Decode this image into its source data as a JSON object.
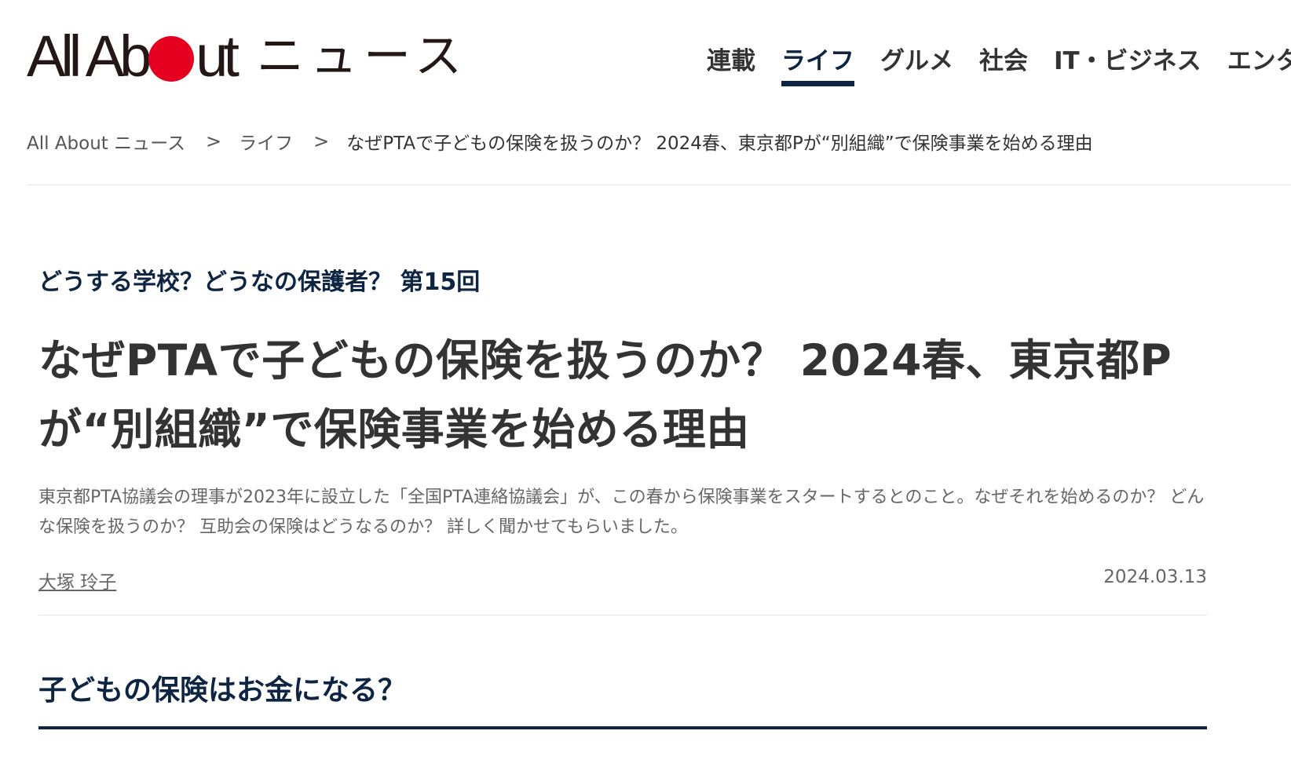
{
  "header": {
    "logo": {
      "mark_left": "All Ab",
      "mark_right": "ut",
      "sub": "ニュース"
    },
    "nav": [
      {
        "label": "連載",
        "active": false
      },
      {
        "label": "ライフ",
        "active": true
      },
      {
        "label": "グルメ",
        "active": false
      },
      {
        "label": "社会",
        "active": false
      },
      {
        "label": "IT・ビジネス",
        "active": false
      },
      {
        "label": "エンタ",
        "active": false
      }
    ]
  },
  "breadcrumb": {
    "home": "All About ニュース",
    "sep": ">",
    "category": "ライフ",
    "current": "なぜPTAで子どもの保険を扱うのか？ 2024春、東京都Pが“別組織”で保険事業を始める理由"
  },
  "article": {
    "series": "どうする学校？どうなの保護者？ 第15回",
    "title": "なぜPTAで子どもの保険を扱うのか？ 2024春、東京都Pが“別組織”で保険事業を始める理由",
    "lead": "東京都PTA協議会の理事が2023年に設立した「全国PTA連絡協議会」が、この春から保険事業をスタートするとのこと。なぜそれを始めるのか？ どんな保険を扱うのか？ 互助会の保険はどうなるのか？ 詳しく聞かせてもらいました。",
    "author": "大塚 玲子",
    "date": "2024.03.13",
    "section_heading": "子どもの保険はお金になる？"
  },
  "colors": {
    "brand_red": "#e60020",
    "navy": "#0d2442",
    "text": "#333333"
  }
}
